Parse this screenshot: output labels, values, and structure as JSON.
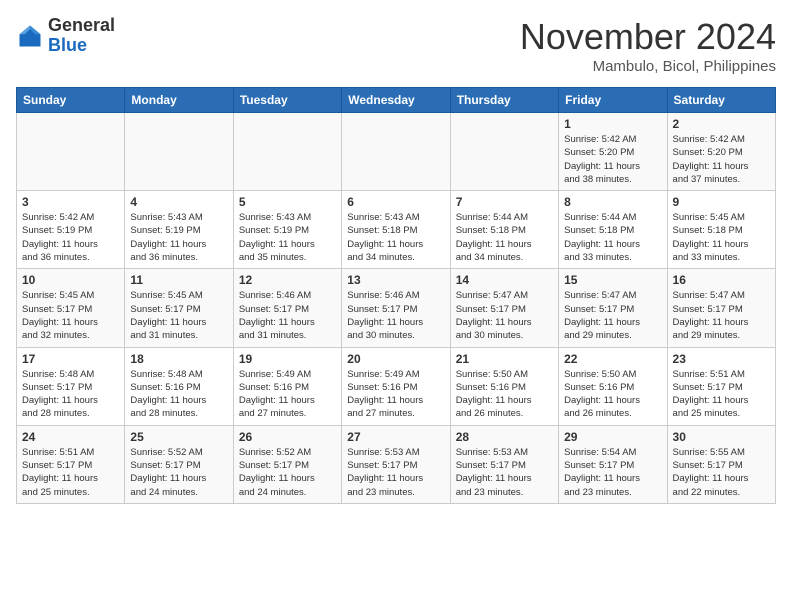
{
  "header": {
    "logo_general": "General",
    "logo_blue": "Blue",
    "month": "November 2024",
    "location": "Mambulo, Bicol, Philippines"
  },
  "weekdays": [
    "Sunday",
    "Monday",
    "Tuesday",
    "Wednesday",
    "Thursday",
    "Friday",
    "Saturday"
  ],
  "weeks": [
    [
      {
        "day": "",
        "info": ""
      },
      {
        "day": "",
        "info": ""
      },
      {
        "day": "",
        "info": ""
      },
      {
        "day": "",
        "info": ""
      },
      {
        "day": "",
        "info": ""
      },
      {
        "day": "1",
        "info": "Sunrise: 5:42 AM\nSunset: 5:20 PM\nDaylight: 11 hours\nand 38 minutes."
      },
      {
        "day": "2",
        "info": "Sunrise: 5:42 AM\nSunset: 5:20 PM\nDaylight: 11 hours\nand 37 minutes."
      }
    ],
    [
      {
        "day": "3",
        "info": "Sunrise: 5:42 AM\nSunset: 5:19 PM\nDaylight: 11 hours\nand 36 minutes."
      },
      {
        "day": "4",
        "info": "Sunrise: 5:43 AM\nSunset: 5:19 PM\nDaylight: 11 hours\nand 36 minutes."
      },
      {
        "day": "5",
        "info": "Sunrise: 5:43 AM\nSunset: 5:19 PM\nDaylight: 11 hours\nand 35 minutes."
      },
      {
        "day": "6",
        "info": "Sunrise: 5:43 AM\nSunset: 5:18 PM\nDaylight: 11 hours\nand 34 minutes."
      },
      {
        "day": "7",
        "info": "Sunrise: 5:44 AM\nSunset: 5:18 PM\nDaylight: 11 hours\nand 34 minutes."
      },
      {
        "day": "8",
        "info": "Sunrise: 5:44 AM\nSunset: 5:18 PM\nDaylight: 11 hours\nand 33 minutes."
      },
      {
        "day": "9",
        "info": "Sunrise: 5:45 AM\nSunset: 5:18 PM\nDaylight: 11 hours\nand 33 minutes."
      }
    ],
    [
      {
        "day": "10",
        "info": "Sunrise: 5:45 AM\nSunset: 5:17 PM\nDaylight: 11 hours\nand 32 minutes."
      },
      {
        "day": "11",
        "info": "Sunrise: 5:45 AM\nSunset: 5:17 PM\nDaylight: 11 hours\nand 31 minutes."
      },
      {
        "day": "12",
        "info": "Sunrise: 5:46 AM\nSunset: 5:17 PM\nDaylight: 11 hours\nand 31 minutes."
      },
      {
        "day": "13",
        "info": "Sunrise: 5:46 AM\nSunset: 5:17 PM\nDaylight: 11 hours\nand 30 minutes."
      },
      {
        "day": "14",
        "info": "Sunrise: 5:47 AM\nSunset: 5:17 PM\nDaylight: 11 hours\nand 30 minutes."
      },
      {
        "day": "15",
        "info": "Sunrise: 5:47 AM\nSunset: 5:17 PM\nDaylight: 11 hours\nand 29 minutes."
      },
      {
        "day": "16",
        "info": "Sunrise: 5:47 AM\nSunset: 5:17 PM\nDaylight: 11 hours\nand 29 minutes."
      }
    ],
    [
      {
        "day": "17",
        "info": "Sunrise: 5:48 AM\nSunset: 5:17 PM\nDaylight: 11 hours\nand 28 minutes."
      },
      {
        "day": "18",
        "info": "Sunrise: 5:48 AM\nSunset: 5:16 PM\nDaylight: 11 hours\nand 28 minutes."
      },
      {
        "day": "19",
        "info": "Sunrise: 5:49 AM\nSunset: 5:16 PM\nDaylight: 11 hours\nand 27 minutes."
      },
      {
        "day": "20",
        "info": "Sunrise: 5:49 AM\nSunset: 5:16 PM\nDaylight: 11 hours\nand 27 minutes."
      },
      {
        "day": "21",
        "info": "Sunrise: 5:50 AM\nSunset: 5:16 PM\nDaylight: 11 hours\nand 26 minutes."
      },
      {
        "day": "22",
        "info": "Sunrise: 5:50 AM\nSunset: 5:16 PM\nDaylight: 11 hours\nand 26 minutes."
      },
      {
        "day": "23",
        "info": "Sunrise: 5:51 AM\nSunset: 5:17 PM\nDaylight: 11 hours\nand 25 minutes."
      }
    ],
    [
      {
        "day": "24",
        "info": "Sunrise: 5:51 AM\nSunset: 5:17 PM\nDaylight: 11 hours\nand 25 minutes."
      },
      {
        "day": "25",
        "info": "Sunrise: 5:52 AM\nSunset: 5:17 PM\nDaylight: 11 hours\nand 24 minutes."
      },
      {
        "day": "26",
        "info": "Sunrise: 5:52 AM\nSunset: 5:17 PM\nDaylight: 11 hours\nand 24 minutes."
      },
      {
        "day": "27",
        "info": "Sunrise: 5:53 AM\nSunset: 5:17 PM\nDaylight: 11 hours\nand 23 minutes."
      },
      {
        "day": "28",
        "info": "Sunrise: 5:53 AM\nSunset: 5:17 PM\nDaylight: 11 hours\nand 23 minutes."
      },
      {
        "day": "29",
        "info": "Sunrise: 5:54 AM\nSunset: 5:17 PM\nDaylight: 11 hours\nand 23 minutes."
      },
      {
        "day": "30",
        "info": "Sunrise: 5:55 AM\nSunset: 5:17 PM\nDaylight: 11 hours\nand 22 minutes."
      }
    ]
  ]
}
